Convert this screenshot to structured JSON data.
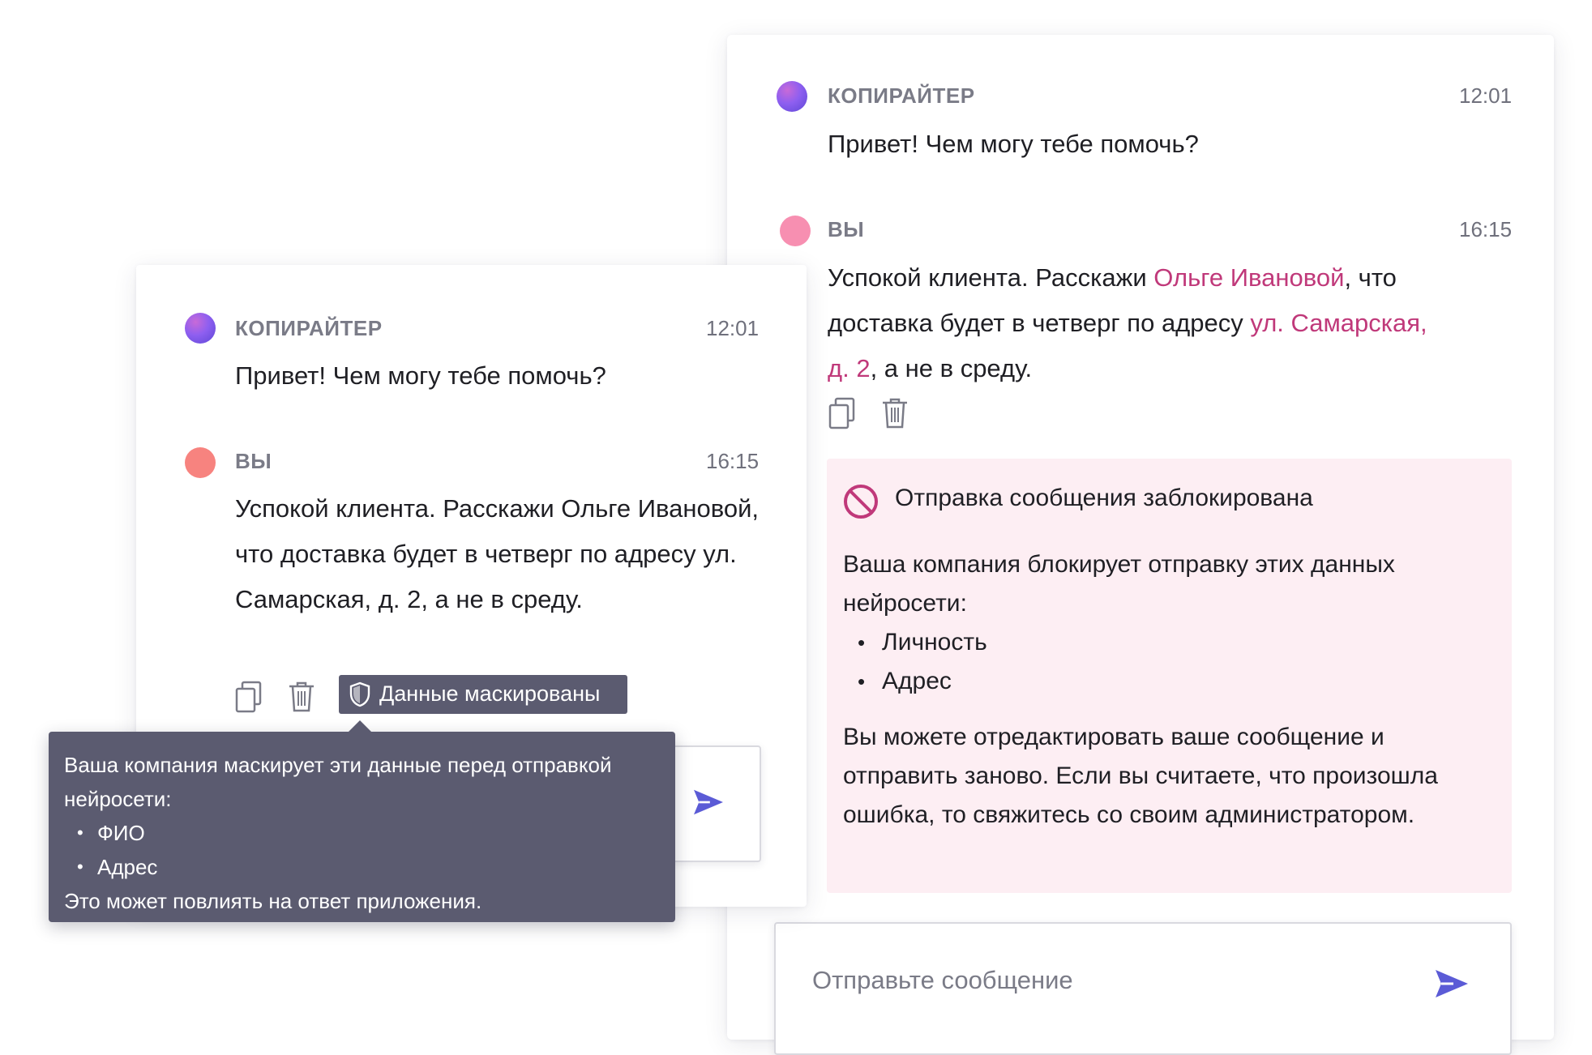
{
  "right_chat": {
    "bot_message": {
      "author": "КОПИРАЙТЕР",
      "time": "12:01",
      "text": "Привет! Чем могу тебе помочь?"
    },
    "user_message": {
      "author": "ВЫ",
      "time": "16:15",
      "line1_a": "Успокой клиента. Расскажи ",
      "line1_pii": "Ольге Ивановой",
      "line1_b": ", что",
      "line2_a": "доставка будет в четверг по адресу ",
      "line2_pii": "ул. Самарская,",
      "line3_pii": "д. 2",
      "line3_b": ", а не в среду."
    },
    "blocked_notice": {
      "title": "Отправка сообщения заблокирована",
      "intro": "Ваша компания блокирует отправку этих данных нейросети:",
      "items": [
        "Личность",
        "Адрес"
      ],
      "footer": "Вы можете отредактировать ваше сообщение и отправить заново. Если вы считаете, что произошла ошибка, то свяжитесь со своим администратором."
    },
    "input": {
      "placeholder": "Отправьте сообщение"
    }
  },
  "left_chat": {
    "bot_message": {
      "author": "КОПИРАЙТЕР",
      "time": "12:01",
      "text": "Привет! Чем могу тебе помочь?"
    },
    "user_message": {
      "author": "ВЫ",
      "time": "16:15",
      "text": "Успокой клиента. Расскажи Ольге Ивановой, что доставка будет в четверг по адресу ул. Самарская, д. 2, а не в среду."
    },
    "masked_badge": "Данные маскированы",
    "tooltip": {
      "intro": "Ваша компания маскирует эти данные перед отправкой нейросети:",
      "items": [
        "ФИО",
        "Адрес"
      ],
      "footer": "Это может повлиять на ответ приложения."
    }
  },
  "colors": {
    "pii_highlight": "#c0397a",
    "accent": "#5b5bd6",
    "tooltip_bg": "#5b5b70",
    "blocked_bg": "#fdeef3"
  },
  "icons": [
    "copy-icon",
    "trash-icon",
    "send-icon",
    "block-icon",
    "shield-icon"
  ]
}
